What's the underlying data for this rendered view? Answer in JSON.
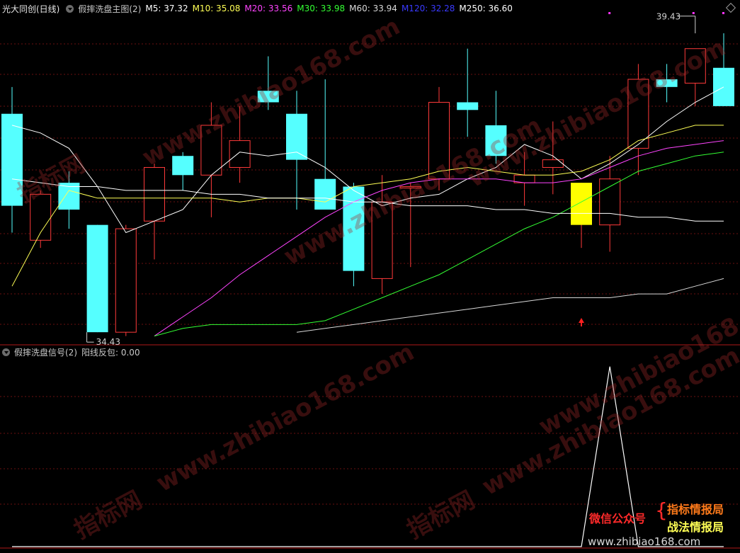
{
  "main_header": {
    "stock": "光大同创(日线)",
    "indicator": "假摔洗盘主图(2)",
    "mas": [
      {
        "label": "M5: 37.32",
        "color": "#ffffff"
      },
      {
        "label": "M10: 35.08",
        "color": "#ffff55"
      },
      {
        "label": "M20: 33.56",
        "color": "#ff44ff"
      },
      {
        "label": "M30: 33.98",
        "color": "#33ff33"
      },
      {
        "label": "M60: 33.94",
        "color": "#d8d8d8"
      },
      {
        "label": "M120: 32.28",
        "color": "#3a3aff"
      },
      {
        "label": "M250: 36.60",
        "color": "#ffffff"
      }
    ]
  },
  "sub_header": {
    "indicator": "假摔洗盘信号(2)",
    "value": "阳线反包: 0.00"
  },
  "chart_data": [
    {
      "type": "candlestick",
      "colors": {
        "up": "#ff3a3a",
        "down": "#55ffff",
        "signal": "#ffff00"
      },
      "candles": [
        {
          "o": 38.3,
          "h": 39.0,
          "l": 35.2,
          "c": 35.9
        },
        {
          "o": 35.0,
          "h": 36.3,
          "l": 34.8,
          "c": 36.2
        },
        {
          "o": 36.5,
          "h": 36.8,
          "l": 35.3,
          "c": 35.8
        },
        {
          "o": 35.4,
          "h": 35.4,
          "l": 34.4,
          "c": 32.6
        },
        {
          "o": 32.6,
          "h": 35.4,
          "l": 32.5,
          "c": 35.3
        },
        {
          "o": 35.5,
          "h": 37.0,
          "l": 34.5,
          "c": 36.9
        },
        {
          "o": 37.2,
          "h": 37.3,
          "l": 36.3,
          "c": 36.7
        },
        {
          "o": 36.7,
          "h": 38.6,
          "l": 35.6,
          "c": 38.0
        },
        {
          "o": 36.9,
          "h": 38.5,
          "l": 36.5,
          "c": 37.6
        },
        {
          "o": 38.9,
          "h": 39.8,
          "l": 38.4,
          "c": 38.6
        },
        {
          "o": 38.3,
          "h": 38.9,
          "l": 35.8,
          "c": 37.1
        },
        {
          "o": 36.6,
          "h": 39.2,
          "l": 35.8,
          "c": 35.8
        },
        {
          "o": 36.4,
          "h": 36.5,
          "l": 33.8,
          "c": 34.2
        },
        {
          "o": 34.0,
          "h": 36.7,
          "l": 33.6,
          "c": 36.0
        },
        {
          "o": 36.4,
          "h": 36.5,
          "l": 34.3,
          "c": 36.4
        },
        {
          "o": 36.6,
          "h": 39.0,
          "l": 36.3,
          "c": 38.6
        },
        {
          "o": 38.6,
          "h": 40.0,
          "l": 37.7,
          "c": 38.4
        },
        {
          "o": 38.0,
          "h": 38.9,
          "l": 37.0,
          "c": 37.2
        },
        {
          "o": 36.5,
          "h": 37.3,
          "l": 35.9,
          "c": 36.7
        },
        {
          "o": 36.9,
          "h": 38.1,
          "l": 36.2,
          "c": 37.1
        },
        {
          "o": 36.5,
          "h": 36.5,
          "l": 34.8,
          "c": 35.4,
          "signal": true
        },
        {
          "o": 35.4,
          "h": 37.2,
          "l": 34.7,
          "c": 36.6
        },
        {
          "o": 37.4,
          "h": 39.6,
          "l": 36.7,
          "c": 39.2
        },
        {
          "o": 39.2,
          "h": 39.6,
          "l": 38.6,
          "c": 39.0
        },
        {
          "o": 39.1,
          "h": 39.43,
          "l": 38.5,
          "c": 40.0
        },
        {
          "o": 39.5,
          "h": 40.4,
          "l": 38.6,
          "c": 38.5
        }
      ],
      "ma_lines": [
        {
          "name": "M5",
          "color": "#ffffff",
          "values": [
            38.0,
            37.8,
            37.4,
            36.4,
            35.2,
            35.5,
            35.8,
            36.7,
            37.3,
            37.2,
            37.3,
            36.9,
            36.3,
            35.9,
            36.1,
            36.2,
            36.6,
            36.9,
            37.5,
            37.2,
            36.6,
            37.0,
            37.5,
            38.1,
            38.6,
            39.0
          ]
        },
        {
          "name": "M10",
          "color": "#ffff55",
          "values": [
            33.8,
            35.2,
            36.3,
            36.1,
            36.1,
            36.1,
            36.1,
            36.1,
            36.0,
            36.1,
            36.1,
            36.0,
            36.4,
            36.5,
            36.6,
            36.8,
            36.9,
            36.8,
            36.7,
            36.7,
            36.8,
            37.1,
            37.6,
            37.8,
            38.0,
            38.0
          ]
        },
        {
          "name": "M20",
          "color": "#ff44ff",
          "values": [
            null,
            null,
            null,
            null,
            null,
            32.5,
            33.0,
            33.5,
            34.1,
            34.6,
            35.1,
            35.6,
            36.0,
            36.3,
            36.5,
            36.6,
            36.6,
            36.6,
            36.5,
            36.5,
            36.6,
            36.9,
            37.2,
            37.4,
            37.5,
            37.6
          ]
        },
        {
          "name": "M30",
          "color": "#33ff33",
          "values": [
            null,
            null,
            null,
            null,
            null,
            32.5,
            32.7,
            32.8,
            32.8,
            32.8,
            32.8,
            32.9,
            33.2,
            33.5,
            33.8,
            34.1,
            34.5,
            34.9,
            35.3,
            35.6,
            36.0,
            36.4,
            36.8,
            37.0,
            37.2,
            37.3
          ]
        },
        {
          "name": "M60",
          "color": "#d8d8d8",
          "values": [
            null,
            null,
            null,
            null,
            null,
            null,
            null,
            null,
            null,
            null,
            32.6,
            32.7,
            32.8,
            32.9,
            33.0,
            33.1,
            33.2,
            33.3,
            33.4,
            33.5,
            33.5,
            33.5,
            33.6,
            33.6,
            33.8,
            34.0
          ]
        },
        {
          "name": "M250",
          "color": "#ffffff",
          "values": [
            36.6,
            36.5,
            36.4,
            36.4,
            36.3,
            36.3,
            36.3,
            36.2,
            36.2,
            36.1,
            36.1,
            36.1,
            36.0,
            36.0,
            35.9,
            35.9,
            35.9,
            35.8,
            35.8,
            35.7,
            35.7,
            35.7,
            35.6,
            35.6,
            35.5,
            35.5
          ]
        }
      ],
      "annotations": {
        "high_label": "39.43",
        "low_label": "34.43"
      },
      "ylim": [
        32.4,
        40.9
      ]
    },
    {
      "type": "line",
      "name": "阳线反包",
      "color": "#ffffff",
      "values": [
        0,
        0,
        0,
        0,
        0,
        0,
        0,
        0,
        0,
        0,
        0,
        0,
        0,
        0,
        0,
        0,
        0,
        0,
        0,
        0,
        0,
        1,
        0,
        0,
        0,
        0
      ],
      "ylim": [
        0,
        1.05
      ]
    }
  ],
  "watermarks": [
    "www.zhibiao168.com",
    "www.zhibiao168.com",
    "www.zhibiao168.com",
    "www.zhibiao168.com",
    "www.zhibiao168.com",
    "www.zhibiao168.com",
    "指标网",
    "指标网",
    "指标网"
  ],
  "promo": {
    "wechat": "微信公众号",
    "line1": "指标情报局",
    "line2": "战法情报局",
    "site": "www.zhibiao168.com",
    "wechat_color": "#ff2a2a",
    "line1_color": "#ff7a1a",
    "line2_color": "#ffff55"
  }
}
